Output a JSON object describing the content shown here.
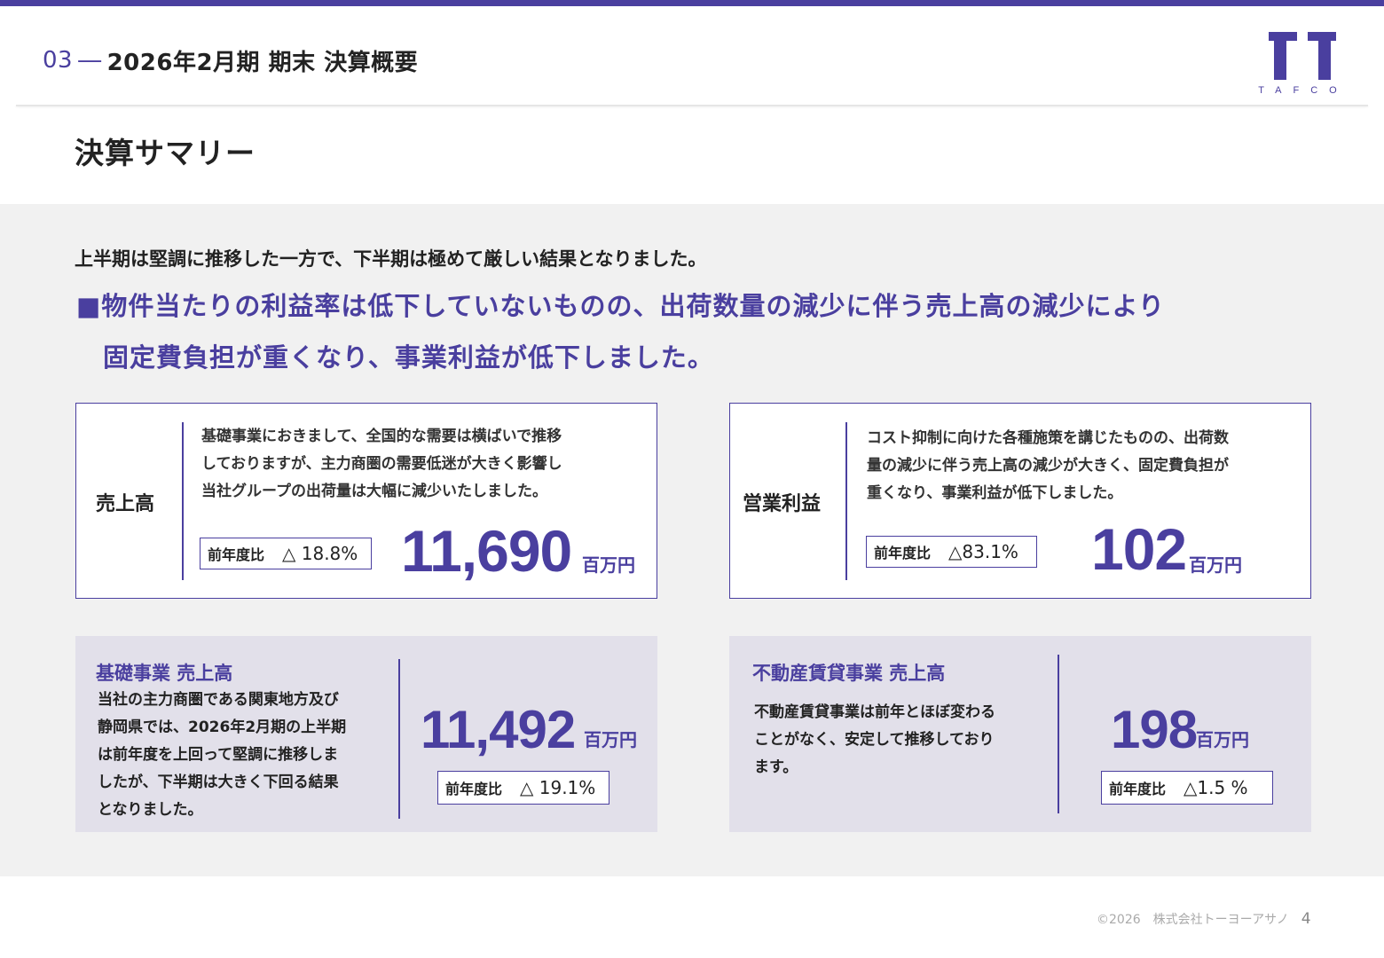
{
  "header": {
    "section_num": "03",
    "dash": "―",
    "title": "2026年2月期 期末 決算概要"
  },
  "logo": {
    "text": "TAFCO",
    "color": "#4a3f9f"
  },
  "page_title": "決算サマリー",
  "lead": "上半期は堅調に推移した一方で、下半期は極めて厳しい結果となりました。",
  "highlight": {
    "line1": "■物件当たりの利益率は低下していないものの、出荷数量の減少に伴う売上高の減少により",
    "line2": "固定費負担が重くなり、事業利益が低下しました。"
  },
  "sales": {
    "label": "売上高",
    "desc": [
      "基礎事業におきまして、全国的な需要は横ばいで推移",
      "しておりますが、主力商圏の需要低迷が大きく影響し",
      "当社グループの出荷量は大幅に減少いたしました。"
    ],
    "yoy_label": "前年度比",
    "yoy_value": "△ 18.8%",
    "value": "11,690",
    "unit": "百万円"
  },
  "op_profit": {
    "label": "営業利益",
    "desc": [
      "コスト抑制に向けた各種施策を講じたものの、出荷数",
      "量の減少に伴う売上高の減少が大きく、固定費負担が",
      "重くなり、事業利益が低下しました。"
    ],
    "yoy_label": "前年度比",
    "yoy_value": "△83.1%",
    "value": "102",
    "unit": "百万円"
  },
  "foundation": {
    "title": "基礎事業 売上高",
    "desc": [
      "当社の主力商圏である関東地方及び",
      "静岡県では、2026年2月期の上半期",
      "は前年度を上回って堅調に推移しま",
      "したが、下半期は大きく下回る結果",
      "となりました。"
    ],
    "value": "11,492",
    "unit": "百万円",
    "yoy_label": "前年度比",
    "yoy_value": "△ 19.1%"
  },
  "realestate": {
    "title": "不動産賃貸事業 売上高",
    "desc": [
      "不動産賃貸事業は前年とほぼ変わる",
      "ことがなく、安定して推移しており",
      "ます。"
    ],
    "value": "198",
    "unit": "百万円",
    "yoy_label": "前年度比",
    "yoy_value": "△1.5 %"
  },
  "footer": {
    "copyright": "©2026　株式会社トーヨーアサノ",
    "page": "4"
  },
  "colors": {
    "accent": "#4a3f9f",
    "panel_bg": "#f1f1f1",
    "segment_bg": "#e2e0ea"
  }
}
